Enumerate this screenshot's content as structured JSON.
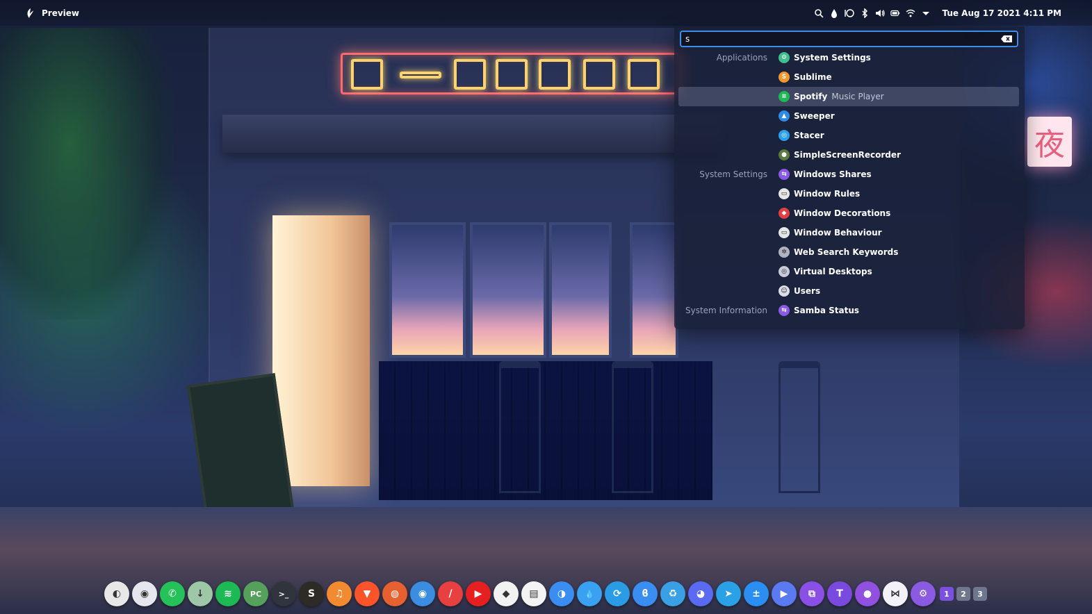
{
  "top_panel": {
    "app_name": "Preview",
    "clock": "Tue Aug 17 2021 4:11 PM",
    "tray_icons": [
      "search-icon",
      "dropper-icon",
      "circle-icon",
      "bluetooth-icon",
      "volume-icon",
      "battery-icon",
      "wifi-icon",
      "arrow-down-icon"
    ]
  },
  "launcher": {
    "query": "s",
    "accent": "#3d8ee8",
    "results": [
      {
        "category": "Applications",
        "title": "System Settings",
        "sub": "",
        "icon": "settings-icon",
        "color": "#3fbf8f",
        "glyph": "⚙"
      },
      {
        "category": "",
        "title": "Sublime",
        "sub": "",
        "icon": "sublime-icon",
        "color": "#f2972e",
        "glyph": "S"
      },
      {
        "category": "",
        "title": "Spotify",
        "sub": "Music Player",
        "icon": "spotify-icon",
        "color": "#1db954",
        "glyph": "≋",
        "selected": true
      },
      {
        "category": "",
        "title": "Sweeper",
        "sub": "",
        "icon": "sweeper-icon",
        "color": "#2f8ae6",
        "glyph": "▲"
      },
      {
        "category": "",
        "title": "Stacer",
        "sub": "",
        "icon": "stacer-icon",
        "color": "#2aa0f2",
        "glyph": "◎"
      },
      {
        "category": "",
        "title": "SimpleScreenRecorder",
        "sub": "",
        "icon": "recorder-icon",
        "color": "#5a7a40",
        "glyph": "●"
      },
      {
        "category": "System Settings",
        "title": "Windows Shares",
        "sub": "",
        "icon": "shares-icon",
        "color": "#8a5ae6",
        "glyph": "⇆"
      },
      {
        "category": "",
        "title": "Window Rules",
        "sub": "",
        "icon": "window-rules-icon",
        "color": "#e6e6e6",
        "glyph": "▭"
      },
      {
        "category": "",
        "title": "Window Decorations",
        "sub": "",
        "icon": "window-decorations-icon",
        "color": "#e04040",
        "glyph": "◆"
      },
      {
        "category": "",
        "title": "Window Behaviour",
        "sub": "",
        "icon": "window-behaviour-icon",
        "color": "#e6e6e6",
        "glyph": "▭"
      },
      {
        "category": "",
        "title": "Web Search Keywords",
        "sub": "",
        "icon": "web-search-icon",
        "color": "#b0b4c0",
        "glyph": "✲"
      },
      {
        "category": "",
        "title": "Virtual Desktops",
        "sub": "",
        "icon": "virtual-desktops-icon",
        "color": "#c8ccd8",
        "glyph": "◎"
      },
      {
        "category": "",
        "title": "Users",
        "sub": "",
        "icon": "users-icon",
        "color": "#dcdfe8",
        "glyph": "☺"
      },
      {
        "category": "System Information",
        "title": "Samba Status",
        "sub": "",
        "icon": "samba-icon",
        "color": "#8a5ae6",
        "glyph": "⇆"
      }
    ]
  },
  "dock": {
    "items": [
      {
        "name": "toggle-icon",
        "color": "#e8e8e8",
        "glyph": "◐"
      },
      {
        "name": "color-picker-icon",
        "color": "#e6e6ee",
        "glyph": "◉"
      },
      {
        "name": "whatsapp-icon",
        "color": "#25c25a",
        "glyph": "✆"
      },
      {
        "name": "download-icon",
        "color": "#9ec7a8",
        "glyph": "↓"
      },
      {
        "name": "spotify-icon",
        "color": "#1db954",
        "glyph": "≋"
      },
      {
        "name": "pycharm-icon",
        "color": "#55a05a",
        "glyph": "PC"
      },
      {
        "name": "terminal-icon",
        "color": "#30343c",
        "glyph": ">_"
      },
      {
        "name": "sublime-icon",
        "color": "#2e2a26",
        "glyph": "S"
      },
      {
        "name": "headphones-icon",
        "color": "#f28a30",
        "glyph": "♫"
      },
      {
        "name": "brave-icon",
        "color": "#fb542b",
        "glyph": "▼"
      },
      {
        "name": "firefox-icon",
        "color": "#e66030",
        "glyph": "◍"
      },
      {
        "name": "chrome-icon",
        "color": "#3a8de0",
        "glyph": "◉"
      },
      {
        "name": "pen-icon",
        "color": "#e84040",
        "glyph": "/"
      },
      {
        "name": "youtube-icon",
        "color": "#e62020",
        "glyph": "▶"
      },
      {
        "name": "ruby-icon",
        "color": "#f2f2f2",
        "glyph": "◆"
      },
      {
        "name": "calendar-icon",
        "color": "#f4f4f4",
        "glyph": "▤"
      },
      {
        "name": "finder-icon",
        "color": "#3a8ef2",
        "glyph": "◑"
      },
      {
        "name": "drop-icon",
        "color": "#3aa0f2",
        "glyph": "💧"
      },
      {
        "name": "sync-icon",
        "color": "#2a9ce6",
        "glyph": "⟳"
      },
      {
        "name": "feather-icon",
        "color": "#3a8ef2",
        "glyph": "ϐ"
      },
      {
        "name": "recycle-icon",
        "color": "#3aa0e6",
        "glyph": "♻"
      },
      {
        "name": "discord-icon",
        "color": "#5a6af2",
        "glyph": "◕"
      },
      {
        "name": "telegram-icon",
        "color": "#2aa0e6",
        "glyph": "➤"
      },
      {
        "name": "calculator-icon",
        "color": "#2a8ef2",
        "glyph": "±"
      },
      {
        "name": "play-icon",
        "color": "#5a7af2",
        "glyph": "▶"
      },
      {
        "name": "crop-icon",
        "color": "#8a50e6",
        "glyph": "⧉"
      },
      {
        "name": "trello-icon",
        "color": "#7a4ae0",
        "glyph": "T"
      },
      {
        "name": "github-icon",
        "color": "#9050e0",
        "glyph": "●"
      },
      {
        "name": "vscode-icon",
        "color": "#f2f2f8",
        "glyph": "⋈"
      },
      {
        "name": "settings-dock-icon",
        "color": "#8a5ae0",
        "glyph": "⚙"
      }
    ],
    "pager": [
      "1",
      "2",
      "3"
    ],
    "active_pager": 0
  }
}
